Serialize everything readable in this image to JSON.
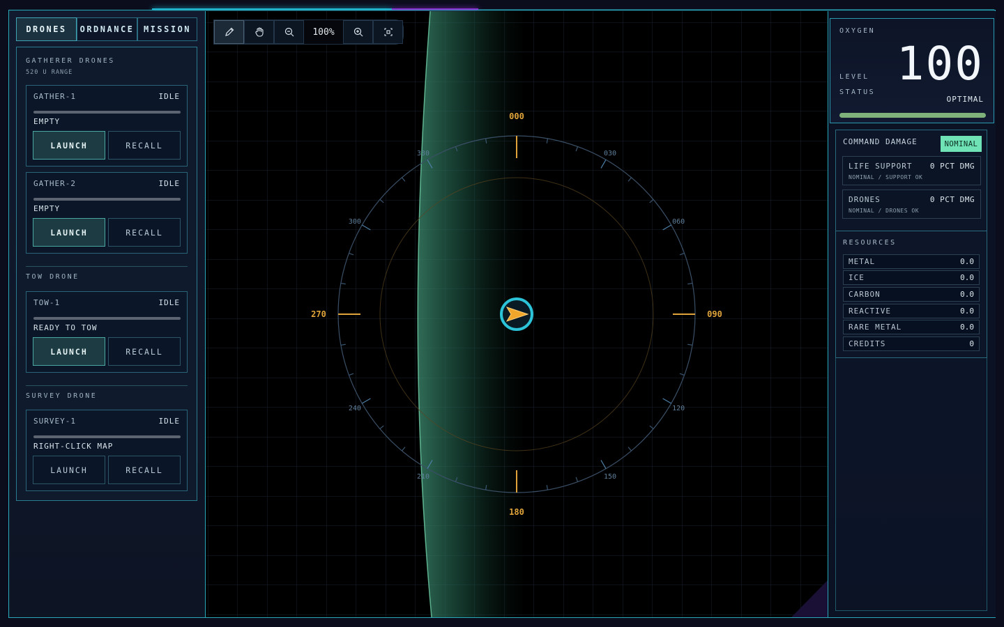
{
  "tabs": [
    "DRONES",
    "ORDNANCE",
    "MISSION"
  ],
  "drones": {
    "gatherer_title": "GATHERER DRONES",
    "gatherer_range": "520 U RANGE",
    "tow_title": "TOW DRONE",
    "survey_title": "SURVEY DRONE",
    "launch_label": "LAUNCH",
    "recall_label": "RECALL",
    "units": [
      {
        "name": "GATHER-1",
        "status": "IDLE",
        "sub": "EMPTY"
      },
      {
        "name": "GATHER-2",
        "status": "IDLE",
        "sub": "EMPTY"
      },
      {
        "name": "TOW-1",
        "status": "IDLE",
        "sub": "READY TO TOW"
      },
      {
        "name": "SURVEY-1",
        "status": "IDLE",
        "sub": "RIGHT-CLICK MAP"
      }
    ]
  },
  "toolbar": {
    "zoom": "100%",
    "icons": [
      "pencil-icon",
      "hand-icon",
      "zoom-out-icon",
      "zoom-in-icon",
      "fit-screen-icon"
    ]
  },
  "compass": {
    "cardinals": [
      "000",
      "090",
      "180",
      "270"
    ],
    "minor": [
      "030",
      "060",
      "120",
      "150",
      "210",
      "240",
      "300",
      "330"
    ]
  },
  "oxygen": {
    "title": "OXYGEN",
    "level_label": "LEVEL",
    "status_label": "STATUS",
    "value": "100",
    "status": "OPTIMAL",
    "fill": 1.0
  },
  "damage": {
    "title": "COMMAND DAMAGE",
    "badge": "NOMINAL",
    "systems": [
      {
        "name": "LIFE SUPPORT",
        "value": "0 PCT DMG",
        "sub": "NOMINAL / SUPPORT OK"
      },
      {
        "name": "DRONES",
        "value": "0 PCT DMG",
        "sub": "NOMINAL / DRONES OK"
      }
    ]
  },
  "resources": {
    "title": "RESOURCES",
    "items": [
      {
        "name": "METAL",
        "value": "0.0"
      },
      {
        "name": "ICE",
        "value": "0.0"
      },
      {
        "name": "CARBON",
        "value": "0.0"
      },
      {
        "name": "REACTIVE",
        "value": "0.0"
      },
      {
        "name": "RARE METAL",
        "value": "0.0"
      },
      {
        "name": "CREDITS",
        "value": "0"
      }
    ]
  },
  "colors": {
    "accent": "#1fb6d1",
    "compass_major": "#e0a43a",
    "nominal": "#6fe3b6",
    "oxygen_bar": "#7fb27a"
  }
}
